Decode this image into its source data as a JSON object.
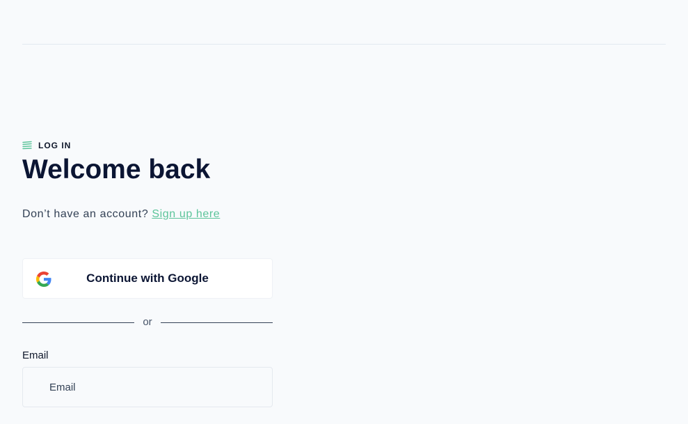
{
  "header": {},
  "login": {
    "eyebrow": "LOG IN",
    "title": "Welcome back",
    "signup_prompt": "Don’t have an account?",
    "signup_link": "Sign up here",
    "google_button": "Continue with Google",
    "divider_text": "or",
    "email_label": "Email",
    "email_placeholder": "Email",
    "email_value": ""
  },
  "colors": {
    "background": "#f8fafc",
    "accent": "#5cc49a",
    "title": "#0b1533"
  },
  "icons": {
    "eyebrow": "stacked-lines-icon",
    "google": "google-icon"
  }
}
